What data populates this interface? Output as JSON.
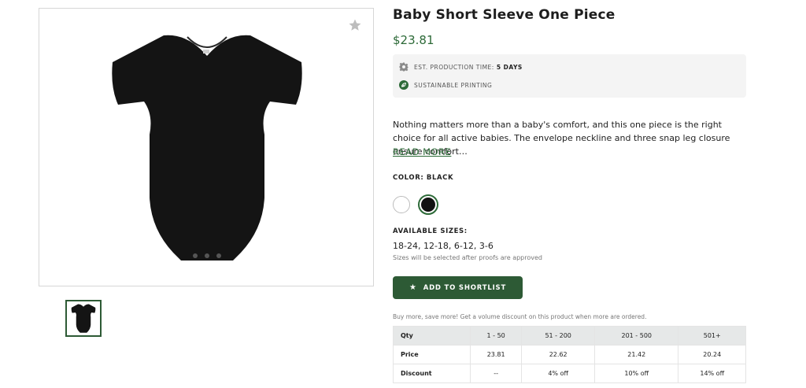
{
  "product": {
    "title": "Baby Short Sleeve One Piece",
    "price": "$23.81",
    "image_icon": "onesie-image"
  },
  "info": {
    "production_label": "EST. PRODUCTION TIME:",
    "production_value": "5 DAYS",
    "sustainable_label": "SUSTAINABLE PRINTING",
    "gear_icon": "gear-icon",
    "leaf_icon": "leaf-icon"
  },
  "description": {
    "text": "Nothing matters more than a baby's comfort, and this one piece is the right choice for all active babies. The envelope neckline and three snap leg closure ensure comfort…",
    "read_more": "READ MORE"
  },
  "color": {
    "label": "COLOR: BLACK",
    "options": [
      {
        "name": "white",
        "hex": "#ffffff"
      },
      {
        "name": "black",
        "hex": "#111111",
        "selected": true
      }
    ]
  },
  "sizes": {
    "label": "AVAILABLE SIZES:",
    "value": "18-24, 12-18, 6-12, 3-6",
    "note": "Sizes will be selected after proofs are approved"
  },
  "actions": {
    "add_label": "ADD TO SHORTLIST",
    "star_glyph": "★"
  },
  "pricing": {
    "note": "Buy more, save more! Get a volume discount on this product when more are ordered.",
    "header": [
      "Qty",
      "1 - 50",
      "51 - 200",
      "201 - 500",
      "501+"
    ],
    "rows": [
      [
        "Price",
        "23.81",
        "22.62",
        "21.42",
        "20.24"
      ],
      [
        "Discount",
        "--",
        "4% off",
        "10% off",
        "14% off"
      ]
    ]
  },
  "colors": {
    "accent_green": "#2d6a38",
    "button_green": "#2d5a35",
    "product_black": "#111111"
  }
}
